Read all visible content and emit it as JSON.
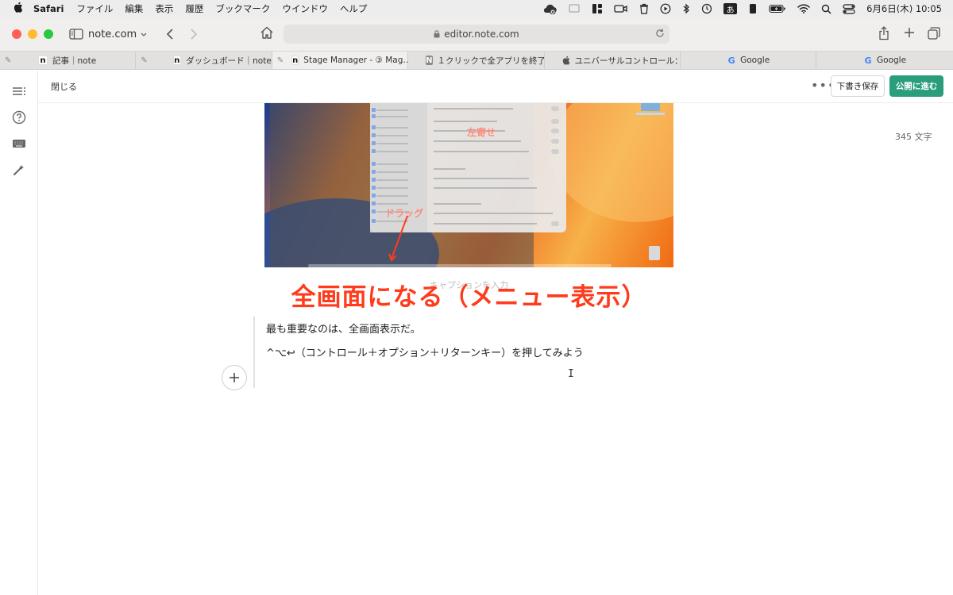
{
  "menubar": {
    "app_name": "Safari",
    "items": [
      "ファイル",
      "編集",
      "表示",
      "履歴",
      "ブックマーク",
      "ウインドウ",
      "ヘルプ"
    ],
    "input_method": "あ",
    "clock": "6月6日(木) 10:05"
  },
  "toolbar": {
    "site_name": "note.com",
    "address": "editor.note.com"
  },
  "tabs": [
    {
      "label": "記事｜note",
      "favicon": "n",
      "pinned": true
    },
    {
      "label": "ダッシュボード｜note",
      "favicon": "n",
      "pinned": true
    },
    {
      "label": "Stage Manager - ③ Mag…",
      "favicon": "n",
      "pinned": true,
      "active": true
    },
    {
      "label": "１クリックで全アプリを終了…",
      "favicon": "N",
      "pinned": false
    },
    {
      "label": "ユニバーサルコントロール：1…",
      "favicon": "apple",
      "pinned": false
    },
    {
      "label": "Google",
      "favicon": "G",
      "pinned": false
    },
    {
      "label": "Google",
      "favicon": "G",
      "pinned": false
    }
  ],
  "editor": {
    "close_label": "閉じる",
    "more_label": "•••",
    "draft_button": "下書き保存",
    "publish_button": "公開に進む",
    "char_count": "345 文字"
  },
  "image": {
    "label_left_align": "左寄せ",
    "label_drag": "ドラッグ",
    "caption_placeholder": "キャプションを入力"
  },
  "overlay_heading": "全画面になる（メニュー表示）",
  "body": {
    "paragraph1": "最も重要なのは、全画面表示だ。",
    "paragraph2": "^⌥↩（コントロール＋オプション＋リターンキー）を押してみよう"
  },
  "colors": {
    "accent_green": "#2a9d7c",
    "overlay_red": "#ff3b1c"
  }
}
